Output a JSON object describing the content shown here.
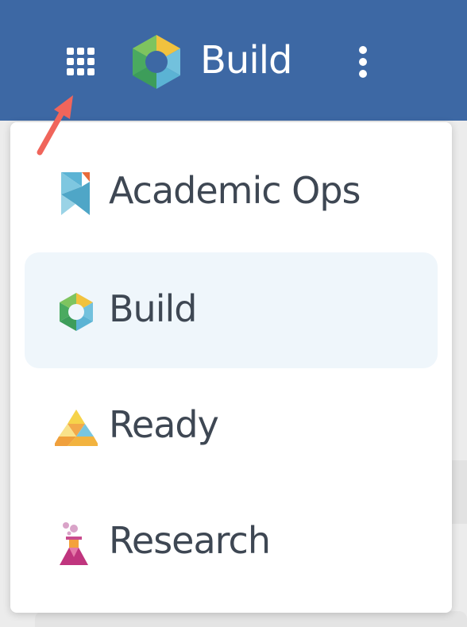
{
  "header": {
    "title": "Build",
    "apps_icon": "grid-icon",
    "logo_icon": "build-hexagon-icon",
    "more_icon": "kebab-icon",
    "background": "#3d68a4"
  },
  "annotation": {
    "arrow_icon": "red-arrow-icon",
    "color": "#f0655b"
  },
  "menu": {
    "items": [
      {
        "label": "Academic Ops",
        "icon": "academic-ops-icon",
        "selected": false
      },
      {
        "label": "Build",
        "icon": "build-hexagon-icon",
        "selected": true
      },
      {
        "label": "Ready",
        "icon": "ready-triangle-icon",
        "selected": false
      },
      {
        "label": "Research",
        "icon": "research-flask-icon",
        "selected": false
      }
    ],
    "selected_background": "#eff6fb",
    "text_color": "#3e4753"
  }
}
